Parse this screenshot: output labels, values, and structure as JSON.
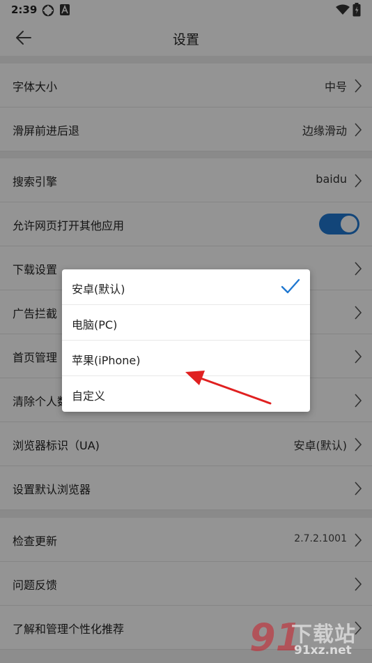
{
  "status_bar": {
    "time": "2:39"
  },
  "header": {
    "title": "设置"
  },
  "settings": {
    "font_size": {
      "label": "字体大小",
      "value": "中号"
    },
    "swipe_nav": {
      "label": "滑屏前进后退",
      "value": "边缘滑动"
    },
    "search_engine": {
      "label": "搜索引擎",
      "value": "baidu"
    },
    "allow_open_apps": {
      "label": "允许网页打开其他应用",
      "enabled": true
    },
    "download": {
      "label": "下载设置"
    },
    "ad_block": {
      "label": "广告拦截"
    },
    "home_manage": {
      "label": "首页管理"
    },
    "clear_personal": {
      "label": "清除个人数据"
    },
    "browser_ua": {
      "label": "浏览器标识（UA)",
      "value": "安卓(默认)"
    },
    "default_browser": {
      "label": "设置默认浏览器"
    },
    "check_update": {
      "label": "检查更新",
      "value": "2.7.2.1001"
    },
    "feedback": {
      "label": "问题反馈"
    },
    "personalization": {
      "label": "了解和管理个性化推荐"
    }
  },
  "ua_dialog": {
    "selected_index": 0,
    "options": [
      {
        "label": "安卓(默认)"
      },
      {
        "label": "电脑(PC)"
      },
      {
        "label": "苹果(iPhone)"
      },
      {
        "label": "自定义"
      }
    ]
  },
  "watermark": {
    "mark": "91",
    "text": "下载站",
    "url": "91xz.net"
  },
  "colors": {
    "accent": "#1f78d1",
    "arrow": "#e02020"
  }
}
